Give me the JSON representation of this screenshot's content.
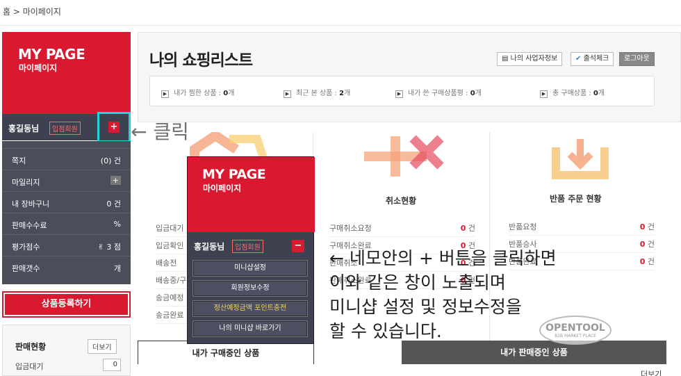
{
  "breadcrumb": "홈 > 마이페이지",
  "sidebar": {
    "title": "MY PAGE",
    "subtitle": "마이페이지",
    "username": "홍길동님",
    "member_badge": "입점회원",
    "plus_label": "+",
    "click_annotation": "← 클릭",
    "menu": [
      {
        "label": "쪽지",
        "value": "(0) 건"
      },
      {
        "label": "마일리지",
        "value": "+"
      },
      {
        "label": "내 장바구니",
        "value": "0 건"
      },
      {
        "label": "판매수수료",
        "value": "%"
      },
      {
        "label": "평가점수",
        "value": "3 점"
      },
      {
        "label": "판매갯수",
        "value": "개"
      }
    ],
    "register_button": "상품등록하기",
    "sales_title": "판매현황",
    "sales_more": "더보기",
    "sales_waiting_label": "입금대기",
    "sales_waiting_value": "0"
  },
  "shopping": {
    "title": "나의 쇼핑리스트",
    "buttons": [
      "나의 사업자정보",
      "출석체크",
      "로그아웃"
    ],
    "stats": [
      {
        "label": "내가 찜한 상품 : ",
        "value": "0",
        "unit": "개"
      },
      {
        "label": "최근 본 상품 : ",
        "value": "2",
        "unit": "개"
      },
      {
        "label": "내가 쓴 구매상품평 : ",
        "value": "0",
        "unit": "개"
      },
      {
        "label": "총 구매상품 : ",
        "value": "0",
        "unit": "개"
      }
    ]
  },
  "columns": {
    "order": {
      "rows": [
        "입금대기",
        "입금확인",
        "배송전",
        "배송중/구",
        "송금예정",
        "송금완료"
      ]
    },
    "cancel": {
      "title": "취소현황",
      "rows": [
        {
          "label": "구매취소요청",
          "value": "0",
          "unit": "건"
        },
        {
          "label": "구매취소완료",
          "value": "0",
          "unit": "건"
        },
        {
          "label": "판매취소",
          "value": "0",
          "unit": "건"
        },
        {
          "label": "판매취소완료",
          "value": "0",
          "unit": "건"
        }
      ]
    },
    "return": {
      "title": "반품 주문 현황",
      "rows": [
        {
          "label": "반품요청",
          "value": "0",
          "unit": "건"
        },
        {
          "label": "반품승사",
          "value": "0",
          "unit": "건"
        },
        {
          "label": "반품완료",
          "value": "0",
          "unit": "건"
        }
      ]
    }
  },
  "tabs": {
    "buying": "내가 구매중인 상품",
    "selling": "내가 판매중인 상품",
    "more": "더보기"
  },
  "popup": {
    "title": "MY PAGE",
    "subtitle": "마이페이지",
    "username": "홍길동님",
    "member_badge": "입점회원",
    "minus_label": "−",
    "buttons": [
      "미니샵설정",
      "회원정보수정",
      "정산예정금액 포인트충전",
      "나의 미니샵 바로가기"
    ]
  },
  "annotation": {
    "line1": "← 네모안의 + 버튼을 클릭하면",
    "line2": "이와 같은 창이 노출되며",
    "line3": "미니샵 설정 및 정보수정을",
    "line4": "할 수 있습니다."
  },
  "watermark": {
    "brand": "OPENTOOL",
    "tagline": "B2B MARKET PLACE"
  },
  "colors": {
    "brand_red": "#d8192f",
    "dark_panel": "#3e4250",
    "highlight": "#20d5d5"
  }
}
